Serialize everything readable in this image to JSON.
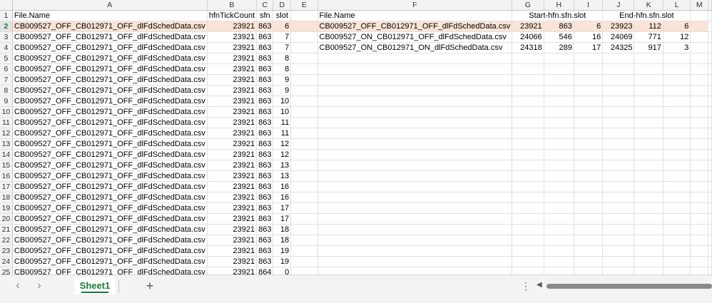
{
  "columns": [
    "A",
    "B",
    "C",
    "D",
    "E",
    "F",
    "G",
    "H",
    "I",
    "J",
    "K",
    "L",
    "M"
  ],
  "rows": [
    [
      "File.Name",
      "hfnTickCount",
      "sfn",
      "slot",
      "",
      "File.Name",
      "Start-hfn.sfn.slot",
      "",
      "",
      "End-hfn.sfn.slot",
      "",
      "",
      ""
    ],
    [
      "CB009527_OFF_CB012971_OFF_dlFdSchedData.csv",
      "23921",
      "863",
      "6",
      "",
      "CB009527_OFF_CB012971_OFF_dlFdSchedData.csv",
      "23921",
      "863",
      "6",
      "23923",
      "112",
      "6",
      ""
    ],
    [
      "CB009527_OFF_CB012971_OFF_dlFdSchedData.csv",
      "23921",
      "863",
      "7",
      "",
      "CB009527_ON_CB012971_OFF_dlFdSchedData.csv",
      "24066",
      "546",
      "16",
      "24069",
      "771",
      "12",
      ""
    ],
    [
      "CB009527_OFF_CB012971_OFF_dlFdSchedData.csv",
      "23921",
      "863",
      "7",
      "",
      "CB009527_ON_CB012971_ON_dlFdSchedData.csv",
      "24318",
      "289",
      "17",
      "24325",
      "917",
      "3",
      ""
    ],
    [
      "CB009527_OFF_CB012971_OFF_dlFdSchedData.csv",
      "23921",
      "863",
      "8",
      "",
      "",
      "",
      "",
      "",
      "",
      "",
      "",
      ""
    ],
    [
      "CB009527_OFF_CB012971_OFF_dlFdSchedData.csv",
      "23921",
      "863",
      "8",
      "",
      "",
      "",
      "",
      "",
      "",
      "",
      "",
      ""
    ],
    [
      "CB009527_OFF_CB012971_OFF_dlFdSchedData.csv",
      "23921",
      "863",
      "9",
      "",
      "",
      "",
      "",
      "",
      "",
      "",
      "",
      ""
    ],
    [
      "CB009527_OFF_CB012971_OFF_dlFdSchedData.csv",
      "23921",
      "863",
      "9",
      "",
      "",
      "",
      "",
      "",
      "",
      "",
      "",
      ""
    ],
    [
      "CB009527_OFF_CB012971_OFF_dlFdSchedData.csv",
      "23921",
      "863",
      "10",
      "",
      "",
      "",
      "",
      "",
      "",
      "",
      "",
      ""
    ],
    [
      "CB009527_OFF_CB012971_OFF_dlFdSchedData.csv",
      "23921",
      "863",
      "10",
      "",
      "",
      "",
      "",
      "",
      "",
      "",
      "",
      ""
    ],
    [
      "CB009527_OFF_CB012971_OFF_dlFdSchedData.csv",
      "23921",
      "863",
      "11",
      "",
      "",
      "",
      "",
      "",
      "",
      "",
      "",
      ""
    ],
    [
      "CB009527_OFF_CB012971_OFF_dlFdSchedData.csv",
      "23921",
      "863",
      "11",
      "",
      "",
      "",
      "",
      "",
      "",
      "",
      "",
      ""
    ],
    [
      "CB009527_OFF_CB012971_OFF_dlFdSchedData.csv",
      "23921",
      "863",
      "12",
      "",
      "",
      "",
      "",
      "",
      "",
      "",
      "",
      ""
    ],
    [
      "CB009527_OFF_CB012971_OFF_dlFdSchedData.csv",
      "23921",
      "863",
      "12",
      "",
      "",
      "",
      "",
      "",
      "",
      "",
      "",
      ""
    ],
    [
      "CB009527_OFF_CB012971_OFF_dlFdSchedData.csv",
      "23921",
      "863",
      "13",
      "",
      "",
      "",
      "",
      "",
      "",
      "",
      "",
      ""
    ],
    [
      "CB009527_OFF_CB012971_OFF_dlFdSchedData.csv",
      "23921",
      "863",
      "13",
      "",
      "",
      "",
      "",
      "",
      "",
      "",
      "",
      ""
    ],
    [
      "CB009527_OFF_CB012971_OFF_dlFdSchedData.csv",
      "23921",
      "863",
      "16",
      "",
      "",
      "",
      "",
      "",
      "",
      "",
      "",
      ""
    ],
    [
      "CB009527_OFF_CB012971_OFF_dlFdSchedData.csv",
      "23921",
      "863",
      "16",
      "",
      "",
      "",
      "",
      "",
      "",
      "",
      "",
      ""
    ],
    [
      "CB009527_OFF_CB012971_OFF_dlFdSchedData.csv",
      "23921",
      "863",
      "17",
      "",
      "",
      "",
      "",
      "",
      "",
      "",
      "",
      ""
    ],
    [
      "CB009527_OFF_CB012971_OFF_dlFdSchedData.csv",
      "23921",
      "863",
      "17",
      "",
      "",
      "",
      "",
      "",
      "",
      "",
      "",
      ""
    ],
    [
      "CB009527_OFF_CB012971_OFF_dlFdSchedData.csv",
      "23921",
      "863",
      "18",
      "",
      "",
      "",
      "",
      "",
      "",
      "",
      "",
      ""
    ],
    [
      "CB009527_OFF_CB012971_OFF_dlFdSchedData.csv",
      "23921",
      "863",
      "18",
      "",
      "",
      "",
      "",
      "",
      "",
      "",
      "",
      ""
    ],
    [
      "CB009527_OFF_CB012971_OFF_dlFdSchedData.csv",
      "23921",
      "863",
      "19",
      "",
      "",
      "",
      "",
      "",
      "",
      "",
      "",
      ""
    ],
    [
      "CB009527_OFF_CB012971_OFF_dlFdSchedData.csv",
      "23921",
      "863",
      "19",
      "",
      "",
      "",
      "",
      "",
      "",
      "",
      "",
      ""
    ],
    [
      "CB009527_OFF_CB012971_OFF_dlFdSchedData.csv",
      "23921",
      "864",
      "0",
      "",
      "",
      "",
      "",
      "",
      "",
      "",
      "",
      ""
    ]
  ],
  "selected_row": 2,
  "sheet_tab": "Sheet1",
  "highlight_color": "#fbe4d6",
  "accent_color": "#1a7a3a",
  "icons": {
    "prev": "chevron-left-icon",
    "next": "chevron-right-icon",
    "add": "plus-icon",
    "more": "more-dots-icon"
  }
}
